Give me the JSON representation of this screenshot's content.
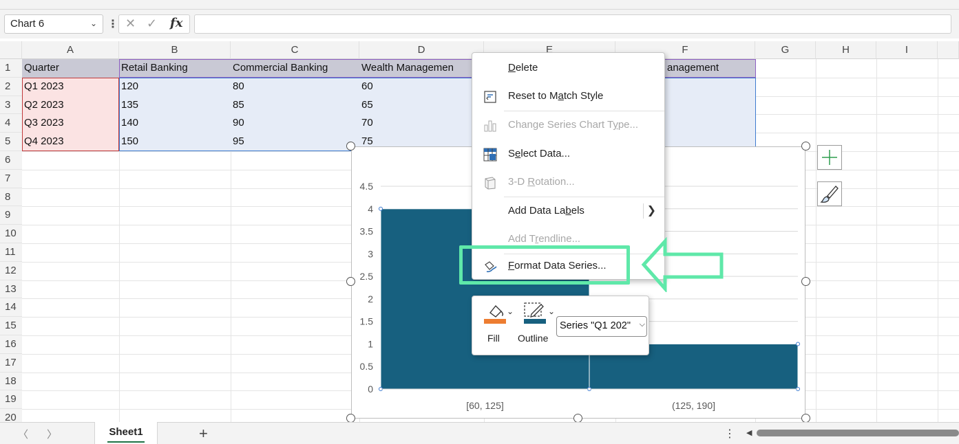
{
  "formula_bar": {
    "name_box": "Chart 6",
    "fx": "fx",
    "formula": ""
  },
  "columns": [
    "A",
    "B",
    "C",
    "D",
    "E",
    "F",
    "G",
    "H",
    "I"
  ],
  "rows": [
    "1",
    "2",
    "3",
    "4",
    "5",
    "6",
    "7",
    "8",
    "9",
    "10",
    "11",
    "12",
    "13",
    "14",
    "15",
    "16",
    "17",
    "18",
    "19",
    "20"
  ],
  "table": {
    "header": [
      "Quarter",
      "Retail Banking",
      "Commercial Banking",
      "Wealth Managemen",
      "anagement"
    ],
    "body": [
      [
        "Q1 2023",
        "120",
        "80",
        "60"
      ],
      [
        "Q2 2023",
        "135",
        "85",
        "65"
      ],
      [
        "Q3 2023",
        "140",
        "90",
        "70"
      ],
      [
        "Q4 2023",
        "150",
        "95",
        "75"
      ]
    ]
  },
  "chart_data": {
    "type": "bar",
    "categories": [
      "[60, 125]",
      "(125, 190]"
    ],
    "values": [
      4,
      1
    ],
    "ylim": [
      0,
      4.5
    ],
    "yticks": [
      "0",
      "0.5",
      "1",
      "1.5",
      "2",
      "2.5",
      "3",
      "3.5",
      "4",
      "4.5"
    ],
    "grid": true,
    "bar_color": "#17607f"
  },
  "context_menu": {
    "items": [
      {
        "label": "Delete",
        "icon": "delete-blank",
        "enabled": true
      },
      {
        "label": "Reset to Match Style",
        "icon": "reset-style-icon",
        "enabled": true
      },
      {
        "label": "Change Series Chart Type...",
        "icon": "chart-type-icon",
        "enabled": false
      },
      {
        "label": "Select Data...",
        "icon": "select-data-icon",
        "enabled": true
      },
      {
        "label": "3-D Rotation...",
        "icon": "rotation-icon",
        "enabled": false
      },
      {
        "label": "Add Data Labels",
        "icon": "none",
        "enabled": true,
        "submenu": true
      },
      {
        "label": "Add Trendline...",
        "icon": "none",
        "enabled": false
      },
      {
        "label": "Format Data Series...",
        "icon": "format-series-icon",
        "enabled": true
      }
    ]
  },
  "mini_toolbar": {
    "fill_label": "Fill",
    "outline_label": "Outline",
    "series_selector": "Series \"Q1 202\"",
    "fill_color": "#ed7d31",
    "outline_color": "#17607f"
  },
  "annotation": {
    "color": "#5fe8a9"
  },
  "sheet_tabs": {
    "active": "Sheet1",
    "add": "+"
  }
}
